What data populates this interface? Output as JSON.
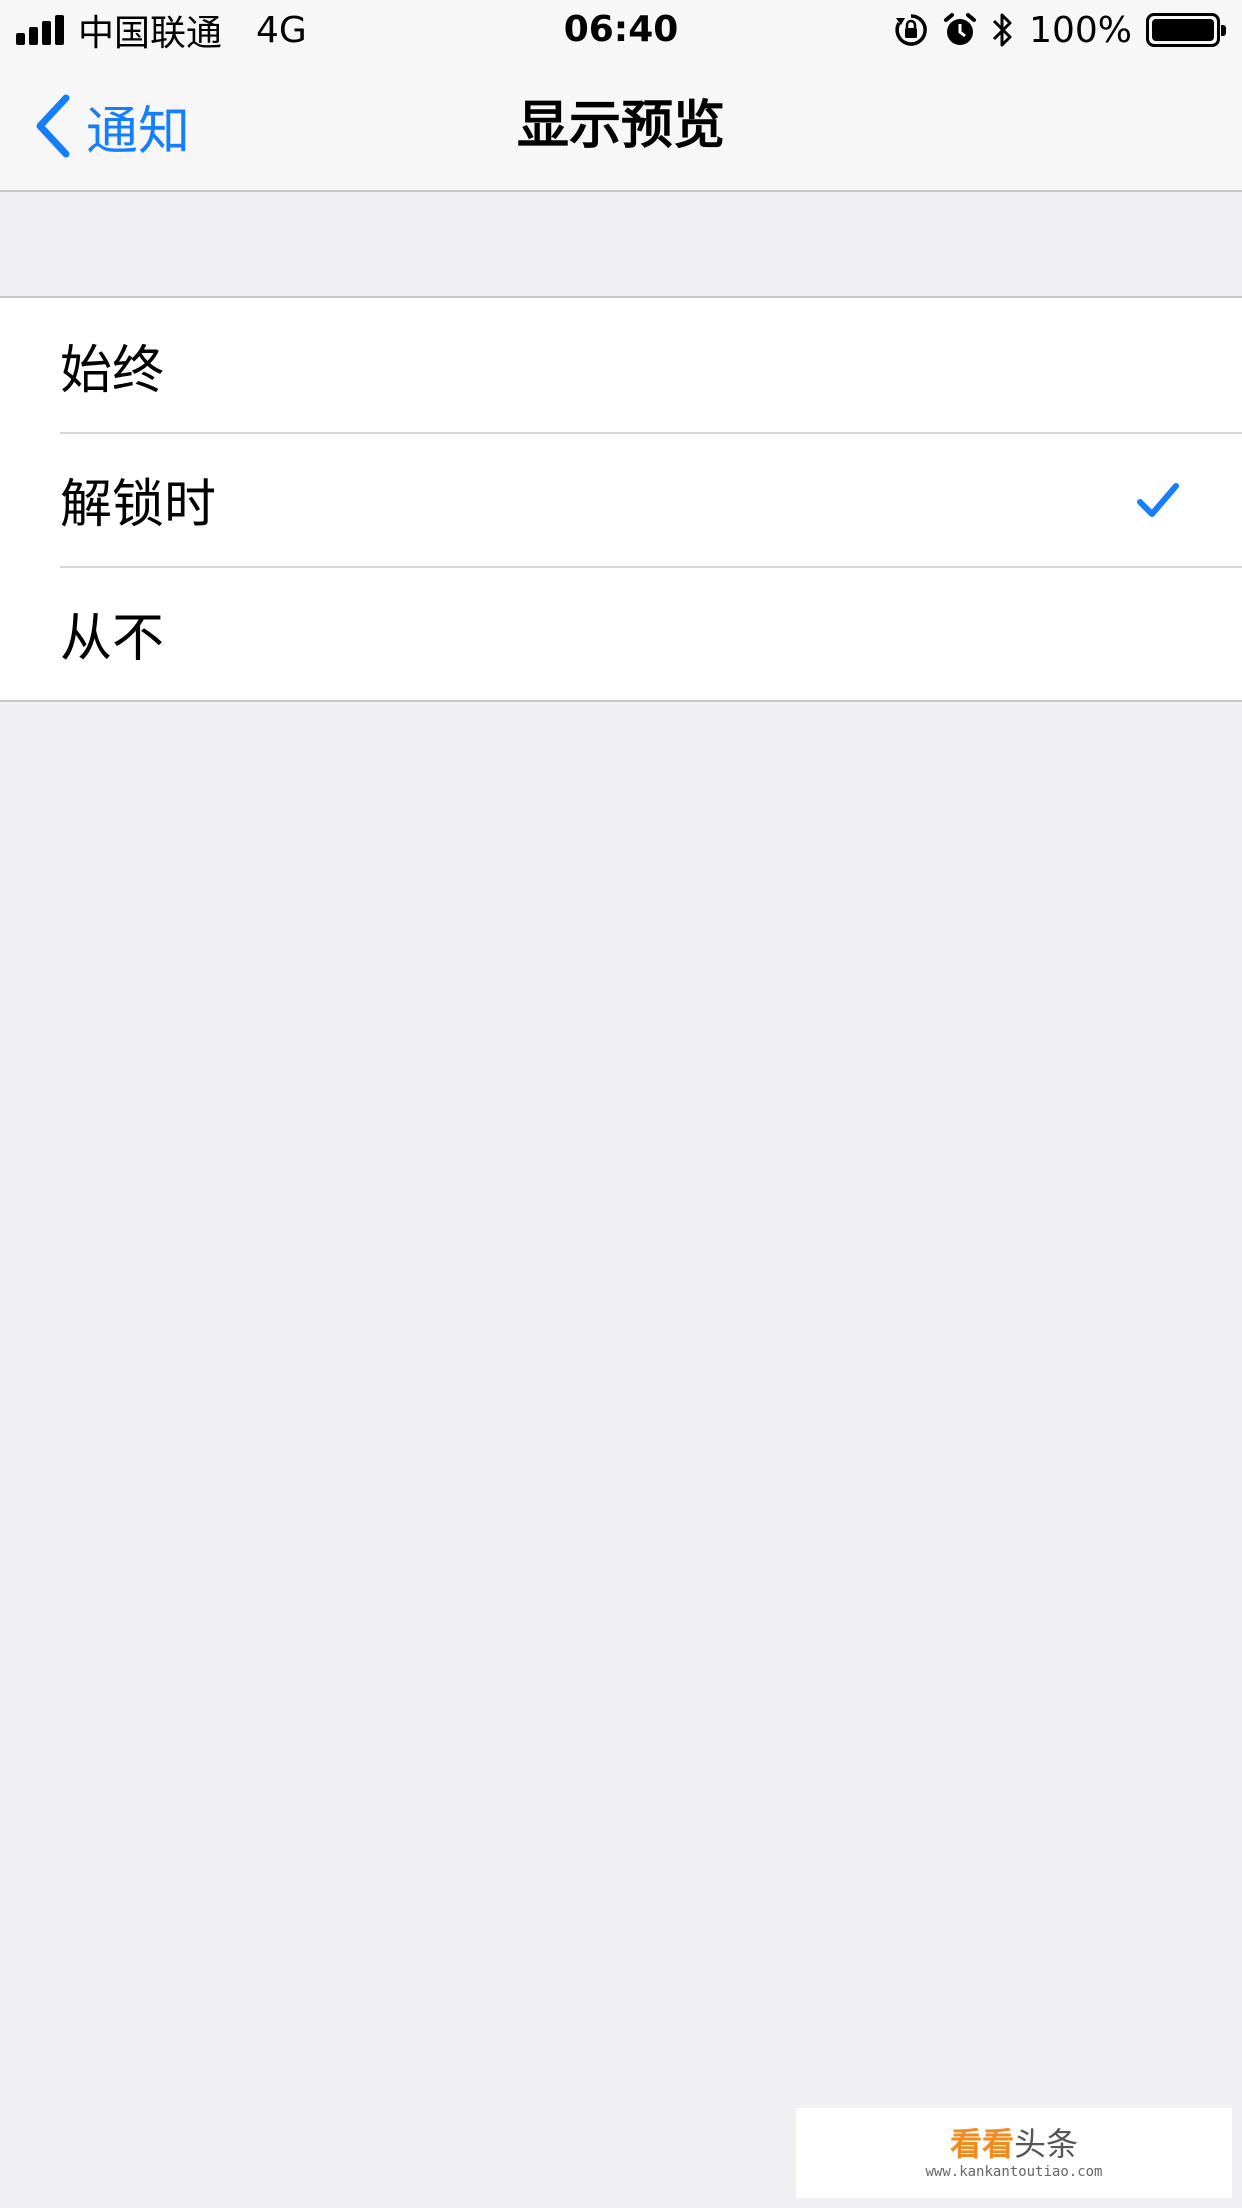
{
  "status_bar": {
    "carrier": "中国联通",
    "network": "4G",
    "time": "06:40",
    "battery": "100%"
  },
  "nav": {
    "back_label": "通知",
    "title": "显示预览"
  },
  "options": [
    {
      "label": "始终",
      "selected": false
    },
    {
      "label": "解锁时",
      "selected": true
    },
    {
      "label": "从不",
      "selected": false
    }
  ],
  "watermark": {
    "brand_a": "看看",
    "brand_b": "头条",
    "url": "www.kankantoutiao.com"
  },
  "colors": {
    "accent": "#157efb",
    "background": "#efeff4",
    "bar": "#f7f7f7"
  }
}
